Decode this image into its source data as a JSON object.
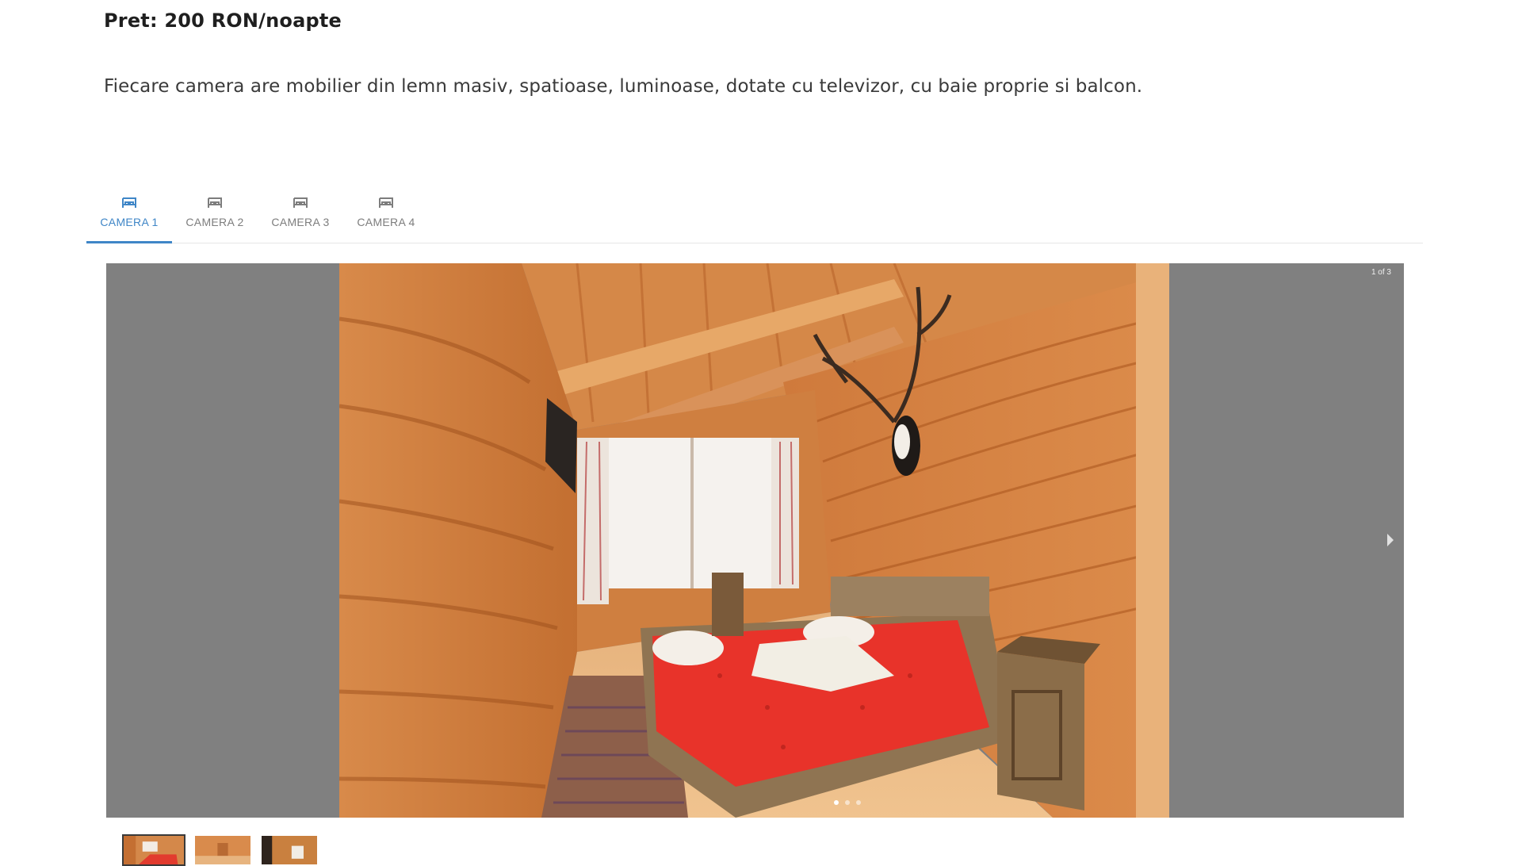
{
  "room": {
    "price_label": "Pret: 200 RON/noapte",
    "description": "Fiecare camera are mobilier din lemn masiv, spatioase, luminoase, dotate cu televizor, cu baie proprie si balcon."
  },
  "tabs": [
    {
      "label": "CAMERA 1",
      "icon": "bed-icon",
      "active": true
    },
    {
      "label": "CAMERA 2",
      "icon": "bed-icon",
      "active": false
    },
    {
      "label": "CAMERA 3",
      "icon": "bed-icon",
      "active": false
    },
    {
      "label": "CAMERA 4",
      "icon": "bed-icon",
      "active": false
    }
  ],
  "gallery": {
    "counter": "1 of 3",
    "current_index": 1,
    "total": 3,
    "next_icon": "chevron-right-icon",
    "thumbnails": [
      {
        "selected": true
      },
      {
        "selected": false
      },
      {
        "selected": false
      }
    ]
  },
  "colors": {
    "accent": "#3f86c7",
    "viewer_bg": "#808080",
    "tab_inactive": "#7d7d7d"
  }
}
